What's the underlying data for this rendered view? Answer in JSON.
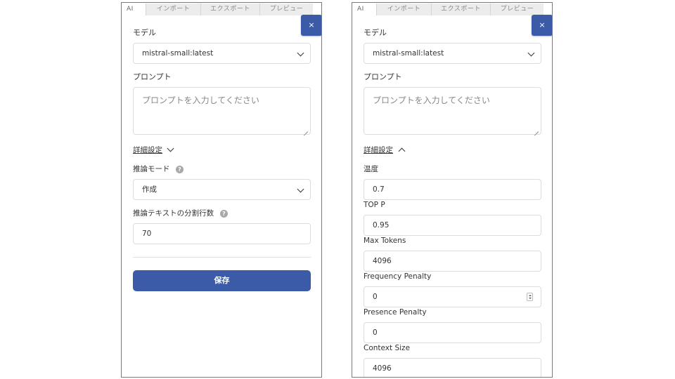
{
  "tabs": {
    "ai": "AI",
    "import": "インポート",
    "export": "エクスポート",
    "preview": "プレビュー"
  },
  "close_label": "×",
  "model": {
    "label": "モデル",
    "value": "mistral-small:latest"
  },
  "prompt": {
    "label": "プロンプト",
    "placeholder": "プロンプトを入力してください"
  },
  "advanced": {
    "label": "詳細設定"
  },
  "left": {
    "inference_mode": {
      "label": "推論モード",
      "value": "作成"
    },
    "split_lines": {
      "label": "推論テキストの分割行数",
      "value": "70"
    },
    "help_icon": "?",
    "save_label": "保存"
  },
  "right": {
    "temperature": {
      "label": "温度",
      "value": "0.7"
    },
    "top_p": {
      "label": "TOP P",
      "value": "0.95"
    },
    "max_tokens": {
      "label": "Max Tokens",
      "value": "4096"
    },
    "frequency_penalty": {
      "label": "Frequency Penalty",
      "value": "0"
    },
    "presence_penalty": {
      "label": "Presence Penalty",
      "value": "0"
    },
    "context_size": {
      "label": "Context Size",
      "value": "4096"
    }
  },
  "icons": {
    "close": "close-icon",
    "dropdown": "chevron-down-icon",
    "collapse": "chevron-up-icon",
    "help": "help-icon",
    "resize": "resize-grip-icon",
    "spinner": "number-spinner-icon"
  },
  "colors": {
    "accent": "#3b5ba9",
    "help_icon": "#a8a8a8",
    "border": "#dcdcdc"
  }
}
